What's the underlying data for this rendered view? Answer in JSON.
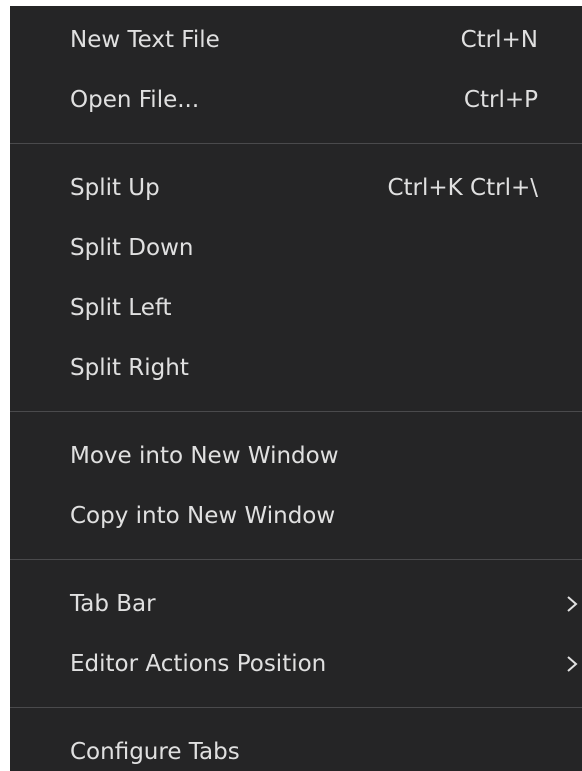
{
  "menu": {
    "items": [
      {
        "label": "New Text File",
        "shortcut": "Ctrl+N"
      },
      {
        "label": "Open File...",
        "shortcut": "Ctrl+P"
      },
      {
        "label": "Split Up",
        "shortcut": "Ctrl+K Ctrl+\\"
      },
      {
        "label": "Split Down"
      },
      {
        "label": "Split Left"
      },
      {
        "label": "Split Right"
      },
      {
        "label": "Move into New Window"
      },
      {
        "label": "Copy into New Window"
      },
      {
        "label": "Tab Bar",
        "submenu_icon": "chevron-right-icon"
      },
      {
        "label": "Editor Actions Position",
        "submenu_icon": "chevron-right-icon"
      },
      {
        "label": "Configure Tabs"
      }
    ]
  },
  "colors": {
    "background": "#252526",
    "text": "#e0e0e0",
    "separator": "#4a4a4c"
  }
}
